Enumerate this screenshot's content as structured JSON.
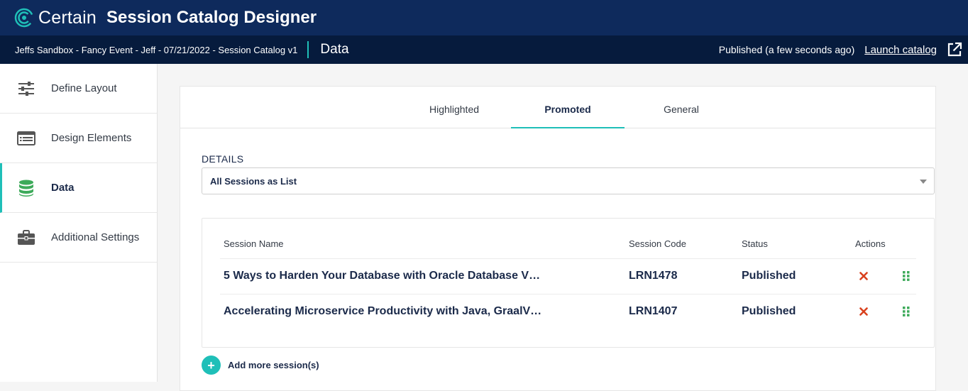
{
  "header": {
    "brand": "Certain",
    "app_title": "Session Catalog Designer"
  },
  "subheader": {
    "breadcrumb": "Jeffs Sandbox - Fancy Event - Jeff - 07/21/2022 - Session Catalog v1",
    "section": "Data",
    "publish_status": "Published (a few seconds ago)",
    "launch_label": "Launch catalog"
  },
  "sidebar": {
    "items": [
      {
        "label": "Define Layout",
        "icon": "sliders-icon"
      },
      {
        "label": "Design Elements",
        "icon": "list-window-icon"
      },
      {
        "label": "Data",
        "icon": "database-icon",
        "active": true
      },
      {
        "label": "Additional Settings",
        "icon": "briefcase-icon"
      }
    ]
  },
  "tabs": [
    {
      "label": "Highlighted"
    },
    {
      "label": "Promoted",
      "active": true
    },
    {
      "label": "General"
    }
  ],
  "details": {
    "label": "DETAILS",
    "selected": "All Sessions as List"
  },
  "table": {
    "columns": [
      "Session Name",
      "Session Code",
      "Status",
      "Actions"
    ],
    "rows": [
      {
        "name": "5 Ways to Harden Your Database with Oracle Database V…",
        "code": "LRN1478",
        "status": "Published"
      },
      {
        "name": "Accelerating Microservice Productivity with Java, GraalV…",
        "code": "LRN1407",
        "status": "Published"
      }
    ]
  },
  "add_more": {
    "symbol": "+",
    "label": "Add more session(s)"
  },
  "colors": {
    "topbar": "#0e2a5c",
    "subbar": "#061b3d",
    "accent": "#1fbfb8",
    "delete": "#d9411e",
    "drag": "#3daa5a"
  }
}
